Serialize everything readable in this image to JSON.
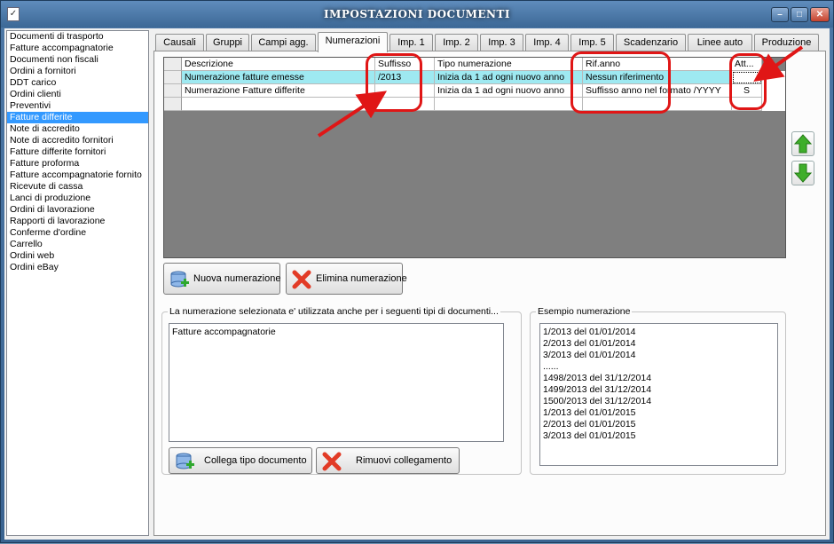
{
  "window": {
    "title": "IMPOSTAZIONI DOCUMENTI",
    "icon": "checklist-app-icon"
  },
  "doc_types": [
    "Documenti di trasporto",
    "Fatture accompagnatorie",
    "Documenti non fiscali",
    "Ordini a fornitori",
    "DDT carico",
    "Ordini clienti",
    "Preventivi",
    "Fatture differite",
    "Note di accredito",
    "Note di accredito fornitori",
    "Fatture differite fornitori",
    "Fatture proforma",
    "Fatture accompagnatorie fornito",
    "Ricevute di cassa",
    "Lanci di produzione",
    "Ordini di lavorazione",
    "Rapporti di lavorazione",
    "Conferme d'ordine",
    "Carrello",
    "Ordini web",
    "Ordini eBay"
  ],
  "selected_doc_type": "Fatture differite",
  "tabs": [
    "Causali",
    "Gruppi",
    "Campi agg.",
    "Numerazioni",
    "Imp. 1",
    "Imp. 2",
    "Imp. 3",
    "Imp. 4",
    "Imp. 5",
    "Scadenzario",
    "Linee auto",
    "Produzione"
  ],
  "active_tab": "Numerazioni",
  "grid": {
    "columns": [
      "Descrizione",
      "Suffisso",
      "Tipo numerazione",
      "Rif.anno",
      "Att..."
    ],
    "rows": [
      {
        "descrizione": "Numerazione fatture emesse",
        "suffisso": "/2013",
        "tipo": "Inizia da 1 ad ogni nuovo anno",
        "rif_anno": "Nessun riferimento",
        "att": ""
      },
      {
        "descrizione": "Numerazione Fatture differite",
        "suffisso": "",
        "tipo": "Inizia da 1 ad ogni nuovo anno",
        "rif_anno": "Suffisso anno nel formato /YYYY",
        "att": "S"
      }
    ]
  },
  "buttons": {
    "new_numbering": "Nuova numerazione",
    "delete_numbering": "Elimina numerazione",
    "link_doc_type": "Collega tipo documento",
    "remove_link": "Rimuovi collegamento"
  },
  "linked_group": {
    "legend": "La numerazione selezionata e' utilizzata anche per i seguenti tipi di documenti...",
    "items": [
      "Fatture accompagnatorie"
    ]
  },
  "example_group": {
    "legend": "Esempio numerazione",
    "lines": [
      "1/2013 del 01/01/2014",
      "2/2013 del 01/01/2014",
      "3/2013 del 01/01/2014",
      "......",
      "1498/2013 del 31/12/2014",
      "1499/2013 del 31/12/2014",
      "1500/2013 del 31/12/2014",
      "1/2013 del 01/01/2015",
      "2/2013 del 01/01/2015",
      "3/2013 del 01/01/2015"
    ]
  },
  "colors": {
    "selection": "#3399ff",
    "row_highlight": "#9ee9f1",
    "annotation": "#e01616",
    "arrow_green": "#3fae2a"
  }
}
